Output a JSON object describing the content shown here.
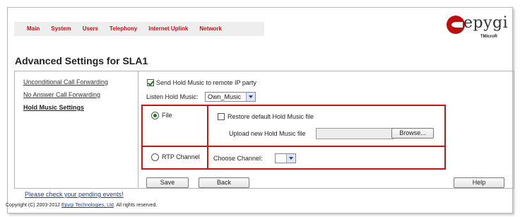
{
  "nav": [
    "Main",
    "System",
    "Users",
    "Telephony",
    "Internet Uplink",
    "Network"
  ],
  "logo": {
    "text": "epygi",
    "subtext": "TMicroR"
  },
  "page_title": "Advanced Settings for SLA1",
  "sidebar": [
    {
      "label": "Unconditional Call Forwarding",
      "active": false
    },
    {
      "label": "No Answer Call Forwarding",
      "active": false
    },
    {
      "label": "Hold Music Settings",
      "active": true
    }
  ],
  "form": {
    "send_hold_music": {
      "label": "Send Hold Music to remote IP party",
      "checked": true
    },
    "listen_hold_music": {
      "label": "Listen Hold Music:",
      "value": "Own_Music"
    },
    "file_option": {
      "label": "File",
      "selected": true
    },
    "restore_default": {
      "label": "Restore default Hold Music file",
      "checked": false
    },
    "upload": {
      "label": "Upload new Hold Music file",
      "value": "",
      "browse_label": "Browse..."
    },
    "rtp_option": {
      "label": "RTP Channel",
      "selected": false
    },
    "choose_channel": {
      "label": "Choose Channel:",
      "value": ""
    }
  },
  "buttons": {
    "save": "Save",
    "back": "Back",
    "help": "Help"
  },
  "footer": {
    "pending_events": "Please check your pending events!",
    "copyright_prefix": "Copyright (C) 2003-2012 ",
    "copyright_link": "Epygi Technologies, Ltd",
    "copyright_suffix": ". All rights reserved."
  },
  "colors": {
    "accent": "#c41616",
    "nav_text": "#c01010",
    "check": "#1a7a1a"
  }
}
